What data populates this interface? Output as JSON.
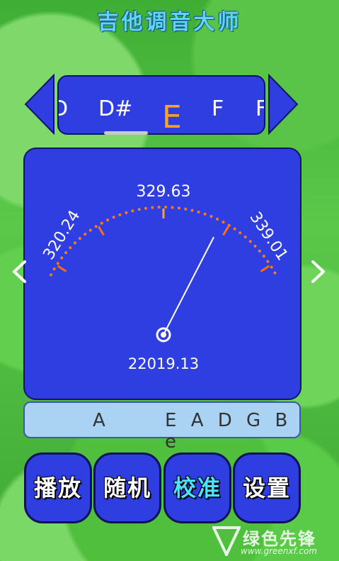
{
  "app": {
    "title": "吉他调音大师"
  },
  "notes": {
    "items": [
      "D",
      "D#",
      "E",
      "F",
      "F"
    ],
    "selected": "E"
  },
  "meter": {
    "target_freq": "329.63",
    "low_freq": "320.24",
    "high_freq": "339.01",
    "detected_freq": "22019.13",
    "needle_position": 0.72
  },
  "strings": {
    "current": "A",
    "tuning": "E A D G B e"
  },
  "buttons": {
    "play": "播放",
    "random": "随机",
    "calibrate": "校准",
    "settings": "设置",
    "selected": "calibrate"
  },
  "colors": {
    "panel": "#2f3ee0",
    "active_note": "#ffa31a",
    "scale_dots": "#ff7a1a",
    "title": "#5fd6ef",
    "selected_button_text": "#4ce3ff"
  },
  "icons": [
    "chevron-left-icon",
    "chevron-right-icon",
    "triangle-left-icon",
    "triangle-right-icon"
  ],
  "watermark": {
    "brand": "绿色先锋",
    "url": "www.greenxf.com"
  }
}
